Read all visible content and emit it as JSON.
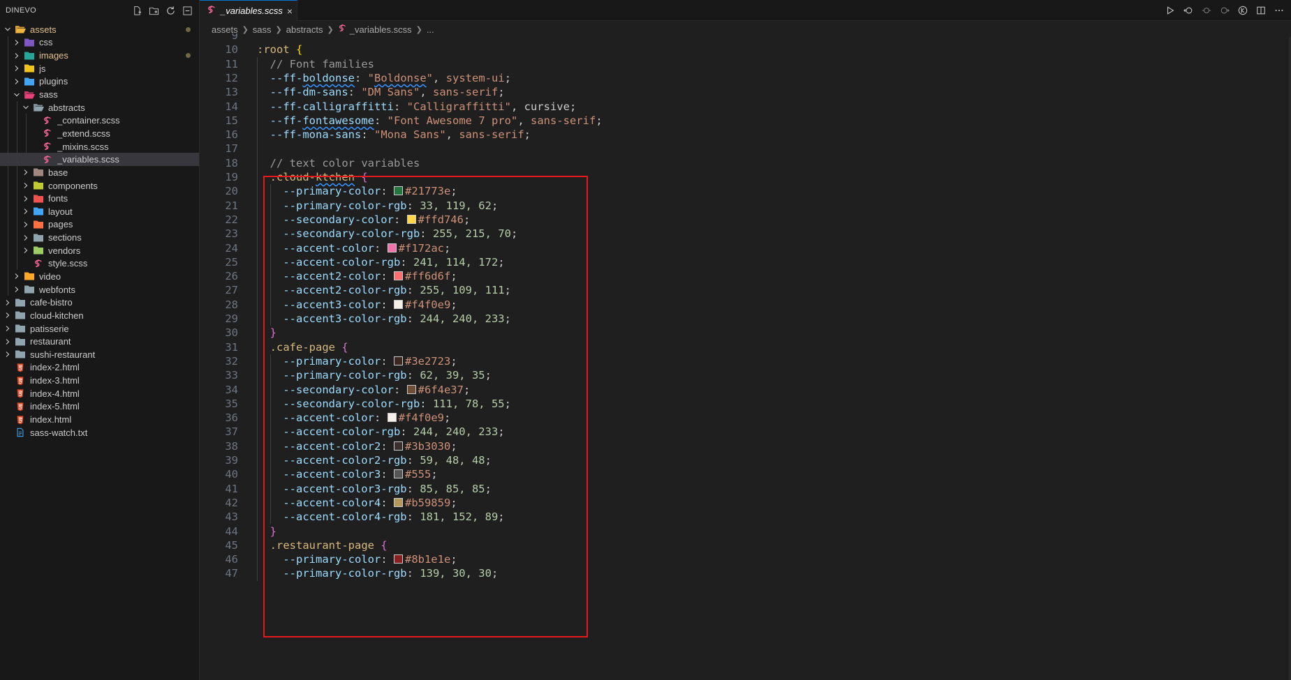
{
  "explorer": {
    "title": "DINEVO",
    "tree": [
      {
        "label": "assets",
        "depth": 0,
        "kind": "folder-assets",
        "expanded": true,
        "modified": true,
        "dot": true
      },
      {
        "label": "css",
        "depth": 1,
        "kind": "folder-css",
        "expanded": false
      },
      {
        "label": "images",
        "depth": 1,
        "kind": "folder-images",
        "expanded": false,
        "modified": true,
        "dot": true
      },
      {
        "label": "js",
        "depth": 1,
        "kind": "folder-js",
        "expanded": false
      },
      {
        "label": "plugins",
        "depth": 1,
        "kind": "folder-plugins",
        "expanded": false
      },
      {
        "label": "sass",
        "depth": 1,
        "kind": "folder-sass",
        "expanded": true
      },
      {
        "label": "abstracts",
        "depth": 2,
        "kind": "folder-plain",
        "expanded": true
      },
      {
        "label": "_container.scss",
        "depth": 3,
        "kind": "file-scss"
      },
      {
        "label": "_extend.scss",
        "depth": 3,
        "kind": "file-scss"
      },
      {
        "label": "_mixins.scss",
        "depth": 3,
        "kind": "file-scss"
      },
      {
        "label": "_variables.scss",
        "depth": 3,
        "kind": "file-scss",
        "selected": true
      },
      {
        "label": "base",
        "depth": 2,
        "kind": "folder-base",
        "expanded": false
      },
      {
        "label": "components",
        "depth": 2,
        "kind": "folder-components",
        "expanded": false
      },
      {
        "label": "fonts",
        "depth": 2,
        "kind": "folder-fonts",
        "expanded": false
      },
      {
        "label": "layout",
        "depth": 2,
        "kind": "folder-layout",
        "expanded": false
      },
      {
        "label": "pages",
        "depth": 2,
        "kind": "folder-pages",
        "expanded": false
      },
      {
        "label": "sections",
        "depth": 2,
        "kind": "folder-plain",
        "expanded": false
      },
      {
        "label": "vendors",
        "depth": 2,
        "kind": "folder-vendors",
        "expanded": false
      },
      {
        "label": "style.scss",
        "depth": 2,
        "kind": "file-scss"
      },
      {
        "label": "video",
        "depth": 1,
        "kind": "folder-video",
        "expanded": false
      },
      {
        "label": "webfonts",
        "depth": 1,
        "kind": "folder-plain",
        "expanded": false
      },
      {
        "label": "cafe-bistro",
        "depth": 0,
        "kind": "folder-plain",
        "expanded": false
      },
      {
        "label": "cloud-kitchen",
        "depth": 0,
        "kind": "folder-plain",
        "expanded": false
      },
      {
        "label": "patisserie",
        "depth": 0,
        "kind": "folder-plain",
        "expanded": false
      },
      {
        "label": "restaurant",
        "depth": 0,
        "kind": "folder-plain",
        "expanded": false
      },
      {
        "label": "sushi-restaurant",
        "depth": 0,
        "kind": "folder-plain",
        "expanded": false
      },
      {
        "label": "index-2.html",
        "depth": 0,
        "kind": "file-html"
      },
      {
        "label": "index-3.html",
        "depth": 0,
        "kind": "file-html"
      },
      {
        "label": "index-4.html",
        "depth": 0,
        "kind": "file-html"
      },
      {
        "label": "index-5.html",
        "depth": 0,
        "kind": "file-html"
      },
      {
        "label": "index.html",
        "depth": 0,
        "kind": "file-html"
      },
      {
        "label": "sass-watch.txt",
        "depth": 0,
        "kind": "file-txt"
      }
    ]
  },
  "tab": {
    "label": "_variables.scss",
    "close": "×"
  },
  "breadcrumb": [
    "assets",
    "sass",
    "abstracts",
    "_variables.scss",
    "..."
  ],
  "colors": {
    "accent": "#0078d4",
    "highlight": "#e51a1a",
    "modified": "#e2c08d"
  },
  "code": [
    {
      "n": "9",
      "tokens": []
    },
    {
      "n": "10",
      "tokens": [
        [
          "sel",
          ":root "
        ],
        [
          "brace2",
          "{"
        ]
      ]
    },
    {
      "n": "11",
      "tokens": [
        [
          "plain",
          "  "
        ],
        [
          "comment",
          "// Font families"
        ]
      ]
    },
    {
      "n": "12",
      "tokens": [
        [
          "plain",
          "  "
        ],
        [
          "prop",
          "--ff-"
        ],
        [
          "prop-sq",
          "boldonse"
        ],
        [
          "punc",
          ": "
        ],
        [
          "str",
          "\""
        ],
        [
          "str-sq",
          "Boldonse"
        ],
        [
          "str",
          "\""
        ],
        [
          "punc",
          ", "
        ],
        [
          "kw",
          "system-ui"
        ],
        [
          "punc",
          ";"
        ]
      ]
    },
    {
      "n": "13",
      "tokens": [
        [
          "plain",
          "  "
        ],
        [
          "prop",
          "--ff-dm-sans"
        ],
        [
          "punc",
          ": "
        ],
        [
          "str",
          "\"DM Sans\""
        ],
        [
          "punc",
          ", "
        ],
        [
          "kw",
          "sans-serif"
        ],
        [
          "punc",
          ";"
        ]
      ]
    },
    {
      "n": "14",
      "tokens": [
        [
          "plain",
          "  "
        ],
        [
          "prop",
          "--ff-calligraffitti"
        ],
        [
          "punc",
          ": "
        ],
        [
          "str",
          "\"Calligraffitti\""
        ],
        [
          "punc",
          ", "
        ],
        [
          "plain",
          "cursive"
        ],
        [
          "punc",
          ";"
        ]
      ]
    },
    {
      "n": "15",
      "tokens": [
        [
          "plain",
          "  "
        ],
        [
          "prop",
          "--ff-"
        ],
        [
          "prop-sq",
          "fontawesome"
        ],
        [
          "punc",
          ": "
        ],
        [
          "str",
          "\"Font Awesome 7 pro\""
        ],
        [
          "punc",
          ", "
        ],
        [
          "kw",
          "sans-serif"
        ],
        [
          "punc",
          ";"
        ]
      ]
    },
    {
      "n": "16",
      "tokens": [
        [
          "plain",
          "  "
        ],
        [
          "prop",
          "--ff-mona-sans"
        ],
        [
          "punc",
          ": "
        ],
        [
          "str",
          "\"Mona Sans\""
        ],
        [
          "punc",
          ", "
        ],
        [
          "kw",
          "sans-serif"
        ],
        [
          "punc",
          ";"
        ]
      ]
    },
    {
      "n": "17",
      "tokens": []
    },
    {
      "n": "18",
      "tokens": [
        [
          "plain",
          "  "
        ],
        [
          "comment",
          "// text color variables"
        ]
      ]
    },
    {
      "n": "19",
      "tokens": [
        [
          "plain",
          "  "
        ],
        [
          "sel",
          "."
        ],
        [
          "sel",
          "cloud-"
        ],
        [
          "sel-sq",
          "ktchen"
        ],
        [
          "sel",
          " "
        ],
        [
          "brace",
          "{"
        ]
      ]
    },
    {
      "n": "20",
      "tokens": [
        [
          "plain",
          "    "
        ],
        [
          "prop",
          "--primary-color"
        ],
        [
          "punc",
          ": "
        ],
        [
          "swatch",
          "#21773e"
        ],
        [
          "color",
          "#21773e"
        ],
        [
          "punc",
          ";"
        ]
      ]
    },
    {
      "n": "21",
      "tokens": [
        [
          "plain",
          "    "
        ],
        [
          "prop",
          "--primary-color-rgb"
        ],
        [
          "punc",
          ": "
        ],
        [
          "num",
          "33, 119, 62"
        ],
        [
          "punc",
          ";"
        ]
      ]
    },
    {
      "n": "22",
      "tokens": [
        [
          "plain",
          "    "
        ],
        [
          "prop",
          "--secondary-color"
        ],
        [
          "punc",
          ": "
        ],
        [
          "swatch",
          "#ffd746"
        ],
        [
          "color",
          "#ffd746"
        ],
        [
          "punc",
          ";"
        ]
      ]
    },
    {
      "n": "23",
      "tokens": [
        [
          "plain",
          "    "
        ],
        [
          "prop",
          "--secondary-color-rgb"
        ],
        [
          "punc",
          ": "
        ],
        [
          "num",
          "255, 215, 70"
        ],
        [
          "punc",
          ";"
        ]
      ]
    },
    {
      "n": "24",
      "tokens": [
        [
          "plain",
          "    "
        ],
        [
          "prop",
          "--accent-color"
        ],
        [
          "punc",
          ": "
        ],
        [
          "swatch",
          "#f172ac"
        ],
        [
          "color",
          "#f172ac"
        ],
        [
          "punc",
          ";"
        ]
      ]
    },
    {
      "n": "25",
      "tokens": [
        [
          "plain",
          "    "
        ],
        [
          "prop",
          "--accent-color-rgb"
        ],
        [
          "punc",
          ": "
        ],
        [
          "num",
          "241, 114, 172"
        ],
        [
          "punc",
          ";"
        ]
      ]
    },
    {
      "n": "26",
      "tokens": [
        [
          "plain",
          "    "
        ],
        [
          "prop",
          "--accent2-color"
        ],
        [
          "punc",
          ": "
        ],
        [
          "swatch",
          "#ff6d6f"
        ],
        [
          "color",
          "#ff6d6f"
        ],
        [
          "punc",
          ";"
        ]
      ]
    },
    {
      "n": "27",
      "tokens": [
        [
          "plain",
          "    "
        ],
        [
          "prop",
          "--accent2-color-rgb"
        ],
        [
          "punc",
          ": "
        ],
        [
          "num",
          "255, 109, 111"
        ],
        [
          "punc",
          ";"
        ]
      ]
    },
    {
      "n": "28",
      "tokens": [
        [
          "plain",
          "    "
        ],
        [
          "prop",
          "--accent3-color"
        ],
        [
          "punc",
          ": "
        ],
        [
          "swatch",
          "#f4f0e9"
        ],
        [
          "color",
          "#f4f0e9"
        ],
        [
          "punc",
          ";"
        ]
      ]
    },
    {
      "n": "29",
      "tokens": [
        [
          "plain",
          "    "
        ],
        [
          "prop",
          "--accent3-color-rgb"
        ],
        [
          "punc",
          ": "
        ],
        [
          "num",
          "244, 240, 233"
        ],
        [
          "punc",
          ";"
        ]
      ]
    },
    {
      "n": "30",
      "tokens": [
        [
          "plain",
          "  "
        ],
        [
          "brace",
          "}"
        ]
      ]
    },
    {
      "n": "31",
      "tokens": [
        [
          "plain",
          "  "
        ],
        [
          "sel",
          ".cafe-page "
        ],
        [
          "brace",
          "{"
        ]
      ]
    },
    {
      "n": "32",
      "tokens": [
        [
          "plain",
          "    "
        ],
        [
          "prop",
          "--primary-color"
        ],
        [
          "punc",
          ": "
        ],
        [
          "swatch",
          "#3e2723"
        ],
        [
          "color",
          "#3e2723"
        ],
        [
          "punc",
          ";"
        ]
      ]
    },
    {
      "n": "33",
      "tokens": [
        [
          "plain",
          "    "
        ],
        [
          "prop",
          "--primary-color-rgb"
        ],
        [
          "punc",
          ": "
        ],
        [
          "num",
          "62, 39, 35"
        ],
        [
          "punc",
          ";"
        ]
      ]
    },
    {
      "n": "34",
      "tokens": [
        [
          "plain",
          "    "
        ],
        [
          "prop",
          "--secondary-color"
        ],
        [
          "punc",
          ": "
        ],
        [
          "swatch",
          "#6f4e37"
        ],
        [
          "color",
          "#6f4e37"
        ],
        [
          "punc",
          ";"
        ]
      ]
    },
    {
      "n": "35",
      "tokens": [
        [
          "plain",
          "    "
        ],
        [
          "prop",
          "--secondary-color-rgb"
        ],
        [
          "punc",
          ": "
        ],
        [
          "num",
          "111, 78, 55"
        ],
        [
          "punc",
          ";"
        ]
      ]
    },
    {
      "n": "36",
      "tokens": [
        [
          "plain",
          "    "
        ],
        [
          "prop",
          "--accent-color"
        ],
        [
          "punc",
          ": "
        ],
        [
          "swatch",
          "#f4f0e9"
        ],
        [
          "color",
          "#f4f0e9"
        ],
        [
          "punc",
          ";"
        ]
      ]
    },
    {
      "n": "37",
      "tokens": [
        [
          "plain",
          "    "
        ],
        [
          "prop",
          "--accent-color-rgb"
        ],
        [
          "punc",
          ": "
        ],
        [
          "num",
          "244, 240, 233"
        ],
        [
          "punc",
          ";"
        ]
      ]
    },
    {
      "n": "38",
      "tokens": [
        [
          "plain",
          "    "
        ],
        [
          "prop",
          "--accent-color2"
        ],
        [
          "punc",
          ": "
        ],
        [
          "swatch",
          "#3b3030"
        ],
        [
          "color",
          "#3b3030"
        ],
        [
          "punc",
          ";"
        ]
      ]
    },
    {
      "n": "39",
      "tokens": [
        [
          "plain",
          "    "
        ],
        [
          "prop",
          "--accent-color2-rgb"
        ],
        [
          "punc",
          ": "
        ],
        [
          "num",
          "59, 48, 48"
        ],
        [
          "punc",
          ";"
        ]
      ]
    },
    {
      "n": "40",
      "tokens": [
        [
          "plain",
          "    "
        ],
        [
          "prop",
          "--accent-color3"
        ],
        [
          "punc",
          ": "
        ],
        [
          "swatch",
          "#555"
        ],
        [
          "color",
          "#555"
        ],
        [
          "punc",
          ";"
        ]
      ]
    },
    {
      "n": "41",
      "tokens": [
        [
          "plain",
          "    "
        ],
        [
          "prop",
          "--accent-color3-rgb"
        ],
        [
          "punc",
          ": "
        ],
        [
          "num",
          "85, 85, 85"
        ],
        [
          "punc",
          ";"
        ]
      ]
    },
    {
      "n": "42",
      "tokens": [
        [
          "plain",
          "    "
        ],
        [
          "prop",
          "--accent-color4"
        ],
        [
          "punc",
          ": "
        ],
        [
          "swatch",
          "#b59859"
        ],
        [
          "color",
          "#b59859"
        ],
        [
          "punc",
          ";"
        ]
      ]
    },
    {
      "n": "43",
      "tokens": [
        [
          "plain",
          "    "
        ],
        [
          "prop",
          "--accent-color4-rgb"
        ],
        [
          "punc",
          ": "
        ],
        [
          "num",
          "181, 152, 89"
        ],
        [
          "punc",
          ";"
        ]
      ]
    },
    {
      "n": "44",
      "tokens": [
        [
          "plain",
          "  "
        ],
        [
          "brace",
          "}"
        ]
      ]
    },
    {
      "n": "45",
      "tokens": [
        [
          "plain",
          "  "
        ],
        [
          "sel",
          ".restaurant-page "
        ],
        [
          "brace",
          "{"
        ]
      ]
    },
    {
      "n": "46",
      "tokens": [
        [
          "plain",
          "    "
        ],
        [
          "prop",
          "--primary-color"
        ],
        [
          "punc",
          ": "
        ],
        [
          "swatch",
          "#8b1e1e"
        ],
        [
          "color",
          "#8b1e1e"
        ],
        [
          "punc",
          ";"
        ]
      ]
    },
    {
      "n": "47",
      "tokens": [
        [
          "plain",
          "    "
        ],
        [
          "prop",
          "--primary-color-rgb"
        ],
        [
          "punc",
          ": "
        ],
        [
          "num",
          "139, 30, 30"
        ],
        [
          "punc",
          ";"
        ]
      ]
    }
  ]
}
